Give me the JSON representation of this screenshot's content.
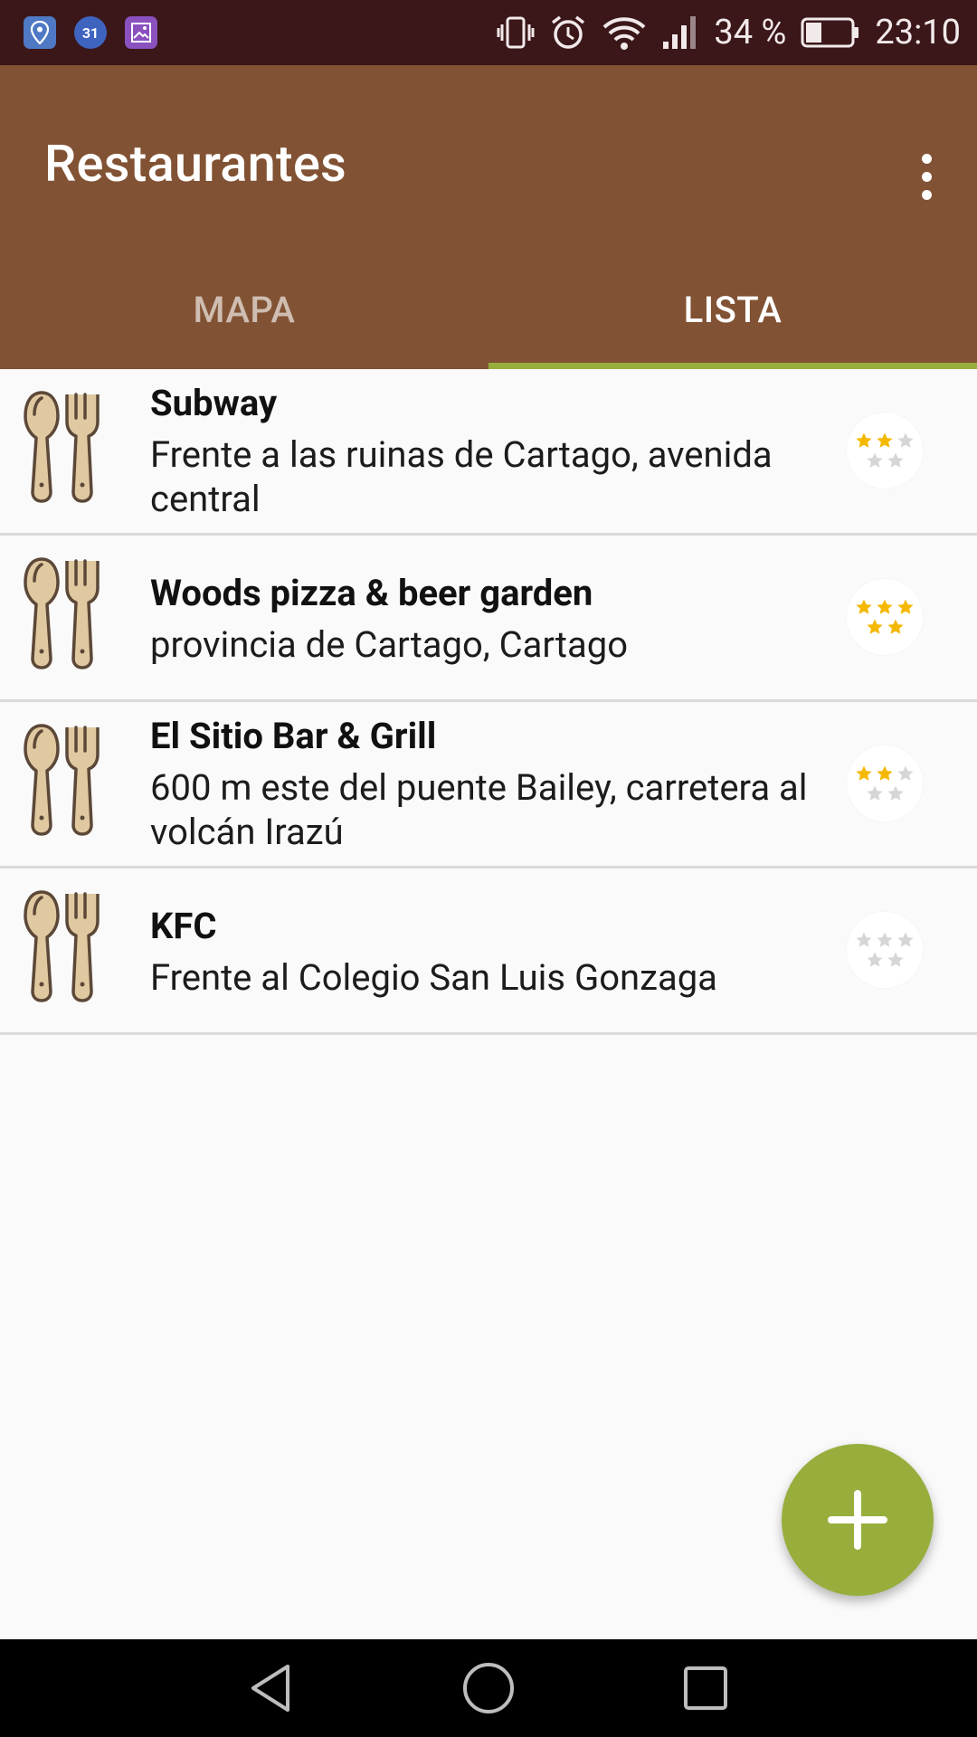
{
  "status_bar": {
    "battery_percent": "34 %",
    "time": "23:10",
    "app_icons": [
      "maps-icon",
      "calendar-icon",
      "gallery-icon"
    ],
    "calendar_day": "31",
    "system_icons": [
      "vibrate-icon",
      "alarm-icon",
      "wifi-icon",
      "signal-icon",
      "battery-icon"
    ]
  },
  "app_bar": {
    "title": "Restaurantes",
    "overflow_icon": "more-vert-icon",
    "colors": {
      "background": "#815233",
      "accent": "#97ae3c"
    }
  },
  "tabs": [
    {
      "label": "MAPA",
      "active": false
    },
    {
      "label": "LISTA",
      "active": true
    }
  ],
  "restaurants": [
    {
      "name": "Subway",
      "address": "Frente a las ruinas de Cartago, avenida central",
      "rating": 2,
      "max_rating": 5,
      "icon": "utensils-icon"
    },
    {
      "name": "Woods pizza & beer garden",
      "address": "provincia de Cartago, Cartago",
      "rating": 5,
      "max_rating": 5,
      "icon": "utensils-icon"
    },
    {
      "name": "El Sitio Bar & Grill",
      "address": "600 m este del puente Bailey, carretera al volcán Irazú",
      "rating": 2,
      "max_rating": 5,
      "icon": "utensils-icon"
    },
    {
      "name": "KFC",
      "address": "Frente al Colegio San Luis Gonzaga",
      "rating": 0,
      "max_rating": 5,
      "icon": "utensils-icon"
    }
  ],
  "fab": {
    "icon": "add-icon"
  },
  "nav_bar": {
    "icons": [
      "back-icon",
      "home-icon",
      "recents-icon"
    ]
  }
}
